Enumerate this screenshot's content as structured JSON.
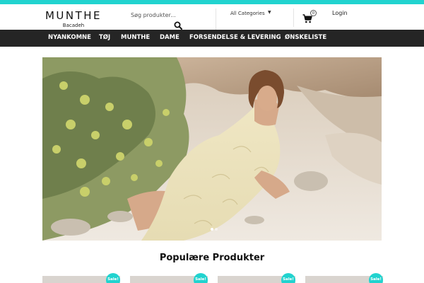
{
  "colors": {
    "accent": "#21d3cf",
    "nav_background": "#252525",
    "nav_text": "#ffffff"
  },
  "brand": {
    "name": "MUNTHE",
    "store": "Bacadeh"
  },
  "search": {
    "placeholder": "Søg produkter...",
    "value": "",
    "icon": "search-icon"
  },
  "category_select": {
    "selected": "All Categories",
    "icon": "chevron-down-icon"
  },
  "cart": {
    "count": "0",
    "icon": "cart-icon"
  },
  "account": {
    "login_label": "Login"
  },
  "nav": {
    "items": [
      {
        "label": "NYANKOMNE"
      },
      {
        "label": "TØJ"
      },
      {
        "label": "MUNTHE"
      },
      {
        "label": "DAME"
      },
      {
        "label": "FORSENDELSE & LEVERING"
      },
      {
        "label": "ØNSKELISTE"
      }
    ]
  },
  "hero": {
    "slide_count": 2,
    "active_slide": 1
  },
  "products_section": {
    "title": "Populære Produkter",
    "cards": [
      {
        "badge": "Sale!"
      },
      {
        "badge": "Sale!"
      },
      {
        "badge": "Sale!"
      },
      {
        "badge": "Sale!"
      }
    ]
  }
}
